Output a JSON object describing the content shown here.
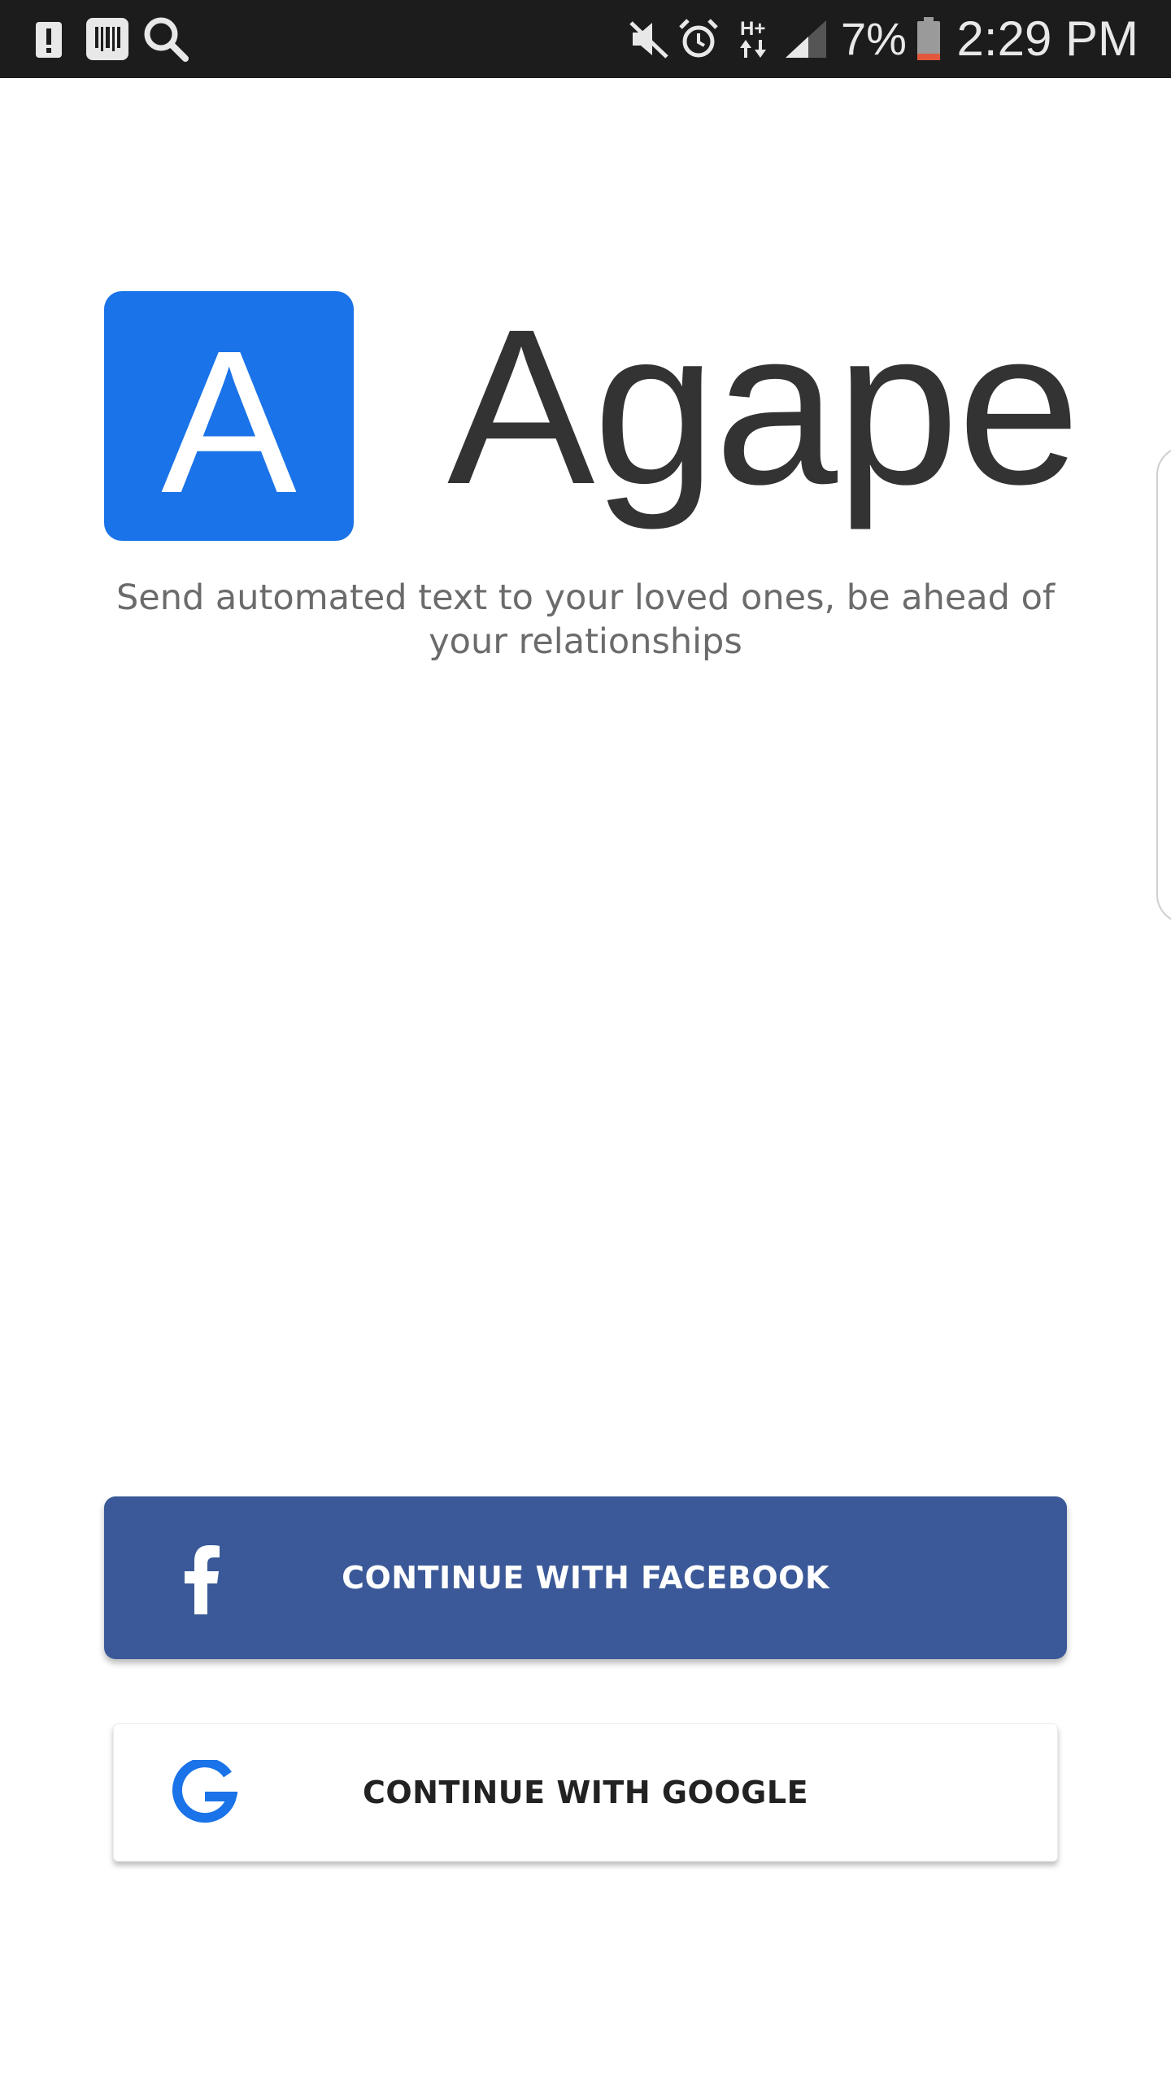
{
  "status_bar": {
    "left_icons": [
      "alert-notification-icon",
      "barcode-app-icon",
      "search-icon"
    ],
    "right_icons": [
      "mute-icon",
      "alarm-icon",
      "data-hplus-icon",
      "signal-icon",
      "battery-low-icon"
    ],
    "battery_percent": "7%",
    "time": "2:29 PM"
  },
  "app": {
    "logo_letter": "A",
    "name": "Agape",
    "tagline": "Send automated text to your loved ones, be ahead of your relationships",
    "brand_color": "#1a73e8"
  },
  "buttons": {
    "facebook": {
      "label": "CONTINUE WITH FACEBOOK",
      "icon": "facebook-icon",
      "color": "#3b5998"
    },
    "google": {
      "label": "CONTINUE WITH GOOGLE",
      "icon": "google-icon",
      "color": "#1a73e8"
    }
  }
}
